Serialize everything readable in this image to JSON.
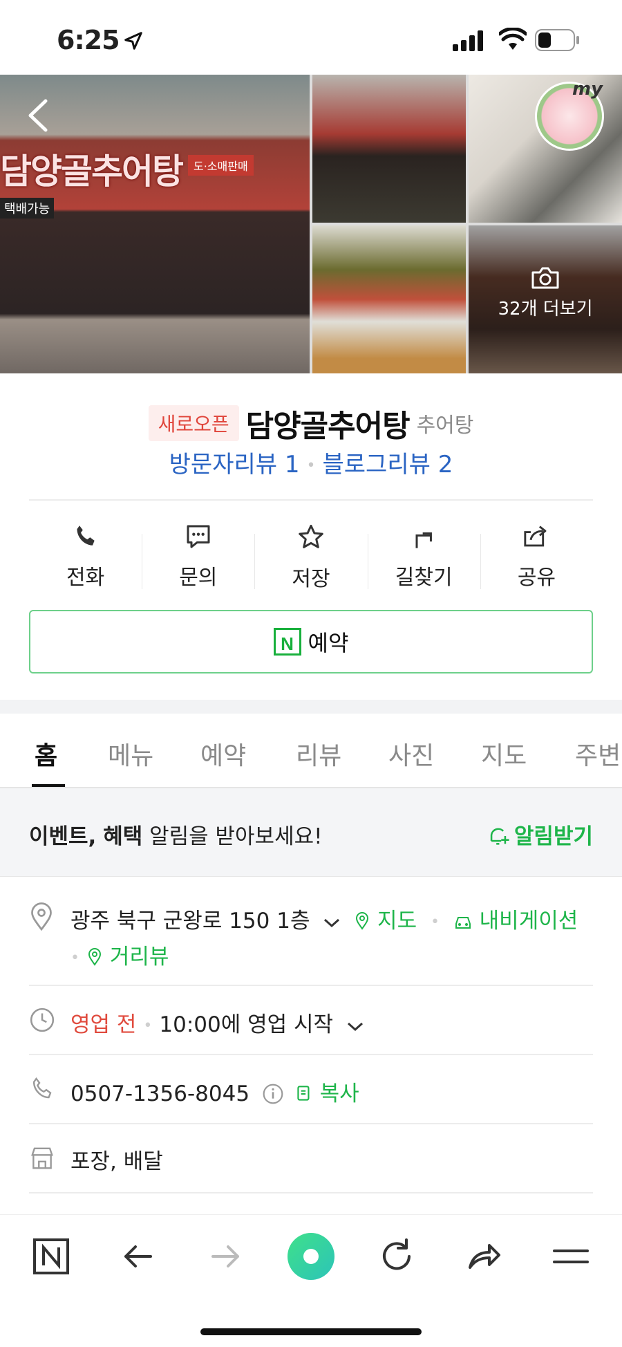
{
  "status_bar": {
    "time": "6:25"
  },
  "photos": {
    "more_label": "32개 더보기",
    "sign_main": "담양골추어탕",
    "sign_small": "도·소매판매",
    "sign_delivery": "택배가능",
    "my_badge": "my"
  },
  "place": {
    "badge": "새로오픈",
    "name": "담양골추어탕",
    "category": "추어탕",
    "visitor_review": "방문자리뷰 1",
    "blog_review": "블로그리뷰 2"
  },
  "actions": [
    {
      "label": "전화",
      "icon": "phone-icon"
    },
    {
      "label": "문의",
      "icon": "chat-icon"
    },
    {
      "label": "저장",
      "icon": "star-icon"
    },
    {
      "label": "길찾기",
      "icon": "directions-icon"
    },
    {
      "label": "공유",
      "icon": "share-icon"
    }
  ],
  "reserve_label": "예약",
  "tabs": [
    "홈",
    "메뉴",
    "예약",
    "리뷰",
    "사진",
    "지도",
    "주변"
  ],
  "notice": {
    "bold1": "이벤트,",
    "bold2": "혜택",
    "rest": " 알림을 받아보세요!",
    "action": "알림받기"
  },
  "address": {
    "text": "광주 북구 군왕로 150 1층",
    "map": "지도",
    "navi": "내비게이션",
    "street": "거리뷰"
  },
  "hours": {
    "status": "영업 전",
    "text": "10:00에 영업 시작"
  },
  "phone": {
    "number": "0507-1356-8045",
    "copy": "복사"
  },
  "services": {
    "text": "포장, 배달"
  },
  "colors": {
    "accent_green": "#1eb54a",
    "link_blue": "#2a64c3",
    "badge_red": "#e0453b"
  }
}
